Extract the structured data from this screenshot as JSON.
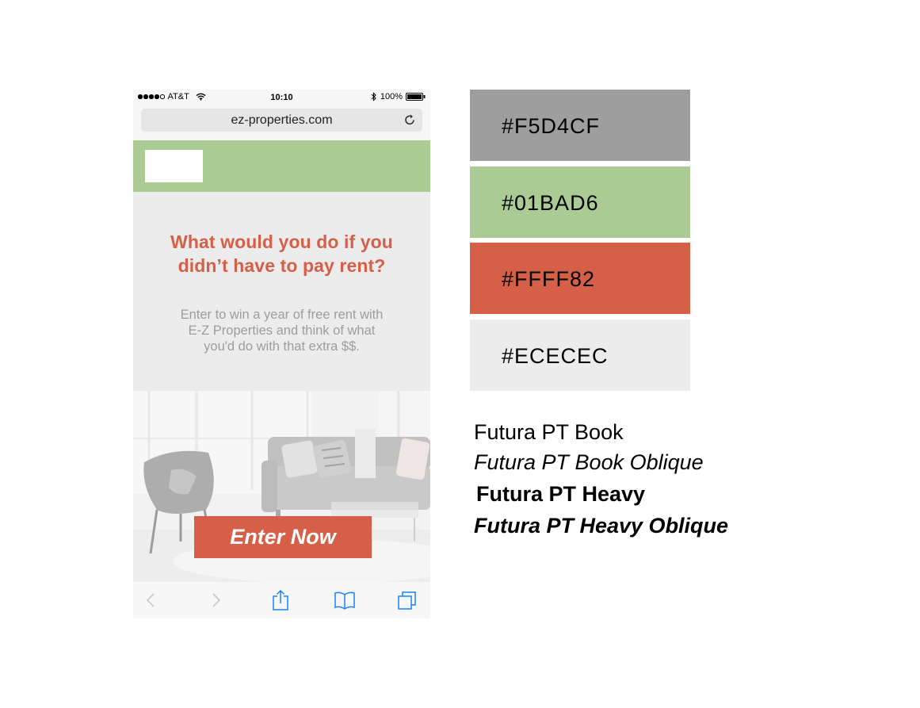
{
  "status_bar": {
    "carrier": "AT&T",
    "time": "10:10",
    "battery": "100%"
  },
  "browser": {
    "url": "ez-properties.com"
  },
  "site": {
    "headline_line1": "What would you do if you",
    "headline_line2": "didn’t have to pay rent?",
    "body_line1": "Enter to win a year of free rent with",
    "body_line2": "E-Z Properties and think of what",
    "body_line3": "you'd do with that extra $$.",
    "cta_label": "Enter Now"
  },
  "colors": {
    "header": "#aacc94",
    "accent": "#d65f48",
    "hero_bg": "#ececec",
    "ios_blue": "#1a82fb"
  },
  "palette": [
    {
      "label": "#F5D4CF",
      "fill": "#9e9e9f"
    },
    {
      "label": "#01BAD6",
      "fill": "#aacc94"
    },
    {
      "label": "#FFFF82",
      "fill": "#d65f48"
    },
    {
      "label": "#ECECEC",
      "fill": "#ececec"
    }
  ],
  "fonts": [
    "Futura PT Book",
    "Futura PT Book Oblique",
    "Futura PT Heavy",
    "Futura PT Heavy Oblique"
  ],
  "icons": [
    "wifi-icon",
    "bluetooth-icon",
    "battery-icon",
    "reload-icon",
    "back-icon",
    "forward-icon",
    "share-icon",
    "bookmarks-icon",
    "tabs-icon"
  ]
}
